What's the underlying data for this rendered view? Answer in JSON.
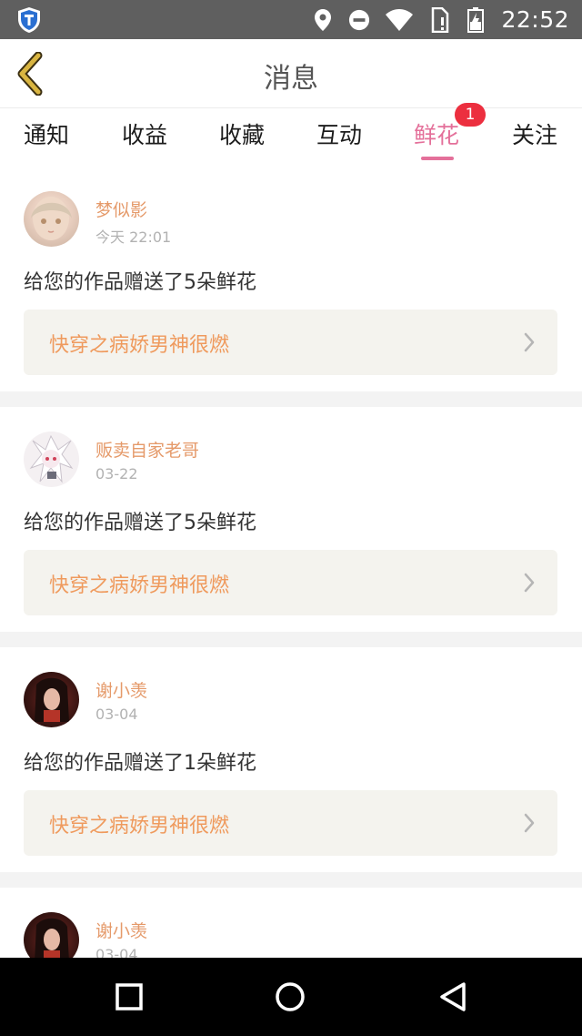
{
  "status_bar": {
    "time": "22:52",
    "icons": [
      "shield-app-icon",
      "location-icon",
      "do-not-disturb-icon",
      "wifi-icon",
      "sim-icon",
      "battery-charging-icon"
    ]
  },
  "header": {
    "title": "消息",
    "back_icon": "chevron-left-icon"
  },
  "tabs": {
    "items": [
      {
        "label": "通知"
      },
      {
        "label": "收益"
      },
      {
        "label": "收藏"
      },
      {
        "label": "互动"
      },
      {
        "label": "鲜花",
        "badge": "1"
      },
      {
        "label": "关注"
      }
    ],
    "active": "鲜花",
    "active_color": "#e4709a"
  },
  "messages": [
    {
      "username": "梦似影",
      "date": "今天 22:01",
      "text": "给您的作品赠送了5朵鲜花",
      "book_title": "快穿之病娇男神很燃"
    },
    {
      "username": "贩卖自家老哥",
      "date": "03-22",
      "text": "给您的作品赠送了5朵鲜花",
      "book_title": "快穿之病娇男神很燃"
    },
    {
      "username": "谢小羡",
      "date": "03-04",
      "text": "给您的作品赠送了1朵鲜花",
      "book_title": "快穿之病娇男神很燃"
    },
    {
      "username": "谢小羡",
      "date": "03-04",
      "text": "",
      "book_title": ""
    }
  ],
  "colors": {
    "username": "#e59a6a",
    "book_title": "#ef9a5d",
    "badge": "#ec2f3f",
    "back_chevron": "#c8a533"
  },
  "nav_bar": {
    "icons": [
      "recents-square-icon",
      "home-circle-icon",
      "back-triangle-icon"
    ]
  }
}
